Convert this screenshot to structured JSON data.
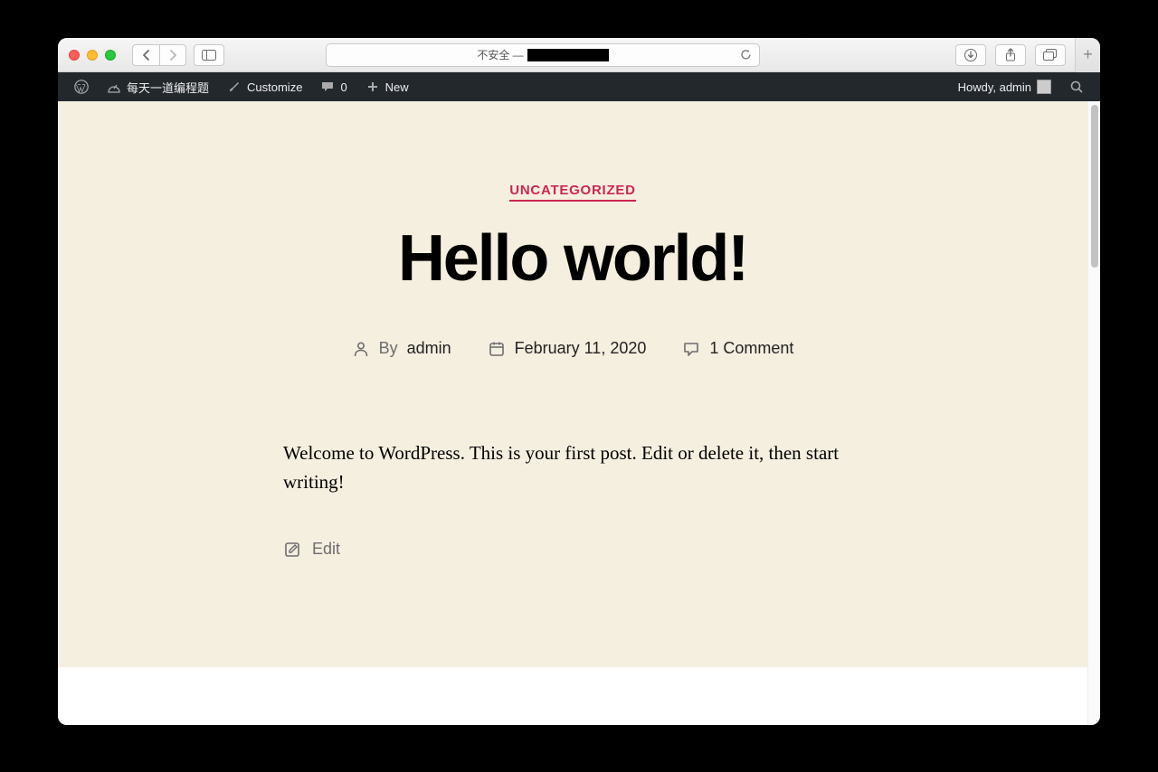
{
  "browser": {
    "address_prefix": "不安全 —"
  },
  "wp_bar": {
    "site_name": "每天一道编程题",
    "customize": "Customize",
    "comment_count": "0",
    "new_label": "New",
    "greeting": "Howdy, admin"
  },
  "post": {
    "category": "UNCATEGORIZED",
    "title": "Hello world!",
    "by_label": "By",
    "author": "admin",
    "date": "February 11, 2020",
    "comments": "1 Comment",
    "body": "Welcome to WordPress. This is your first post. Edit or delete it, then start writing!",
    "edit_label": "Edit"
  }
}
